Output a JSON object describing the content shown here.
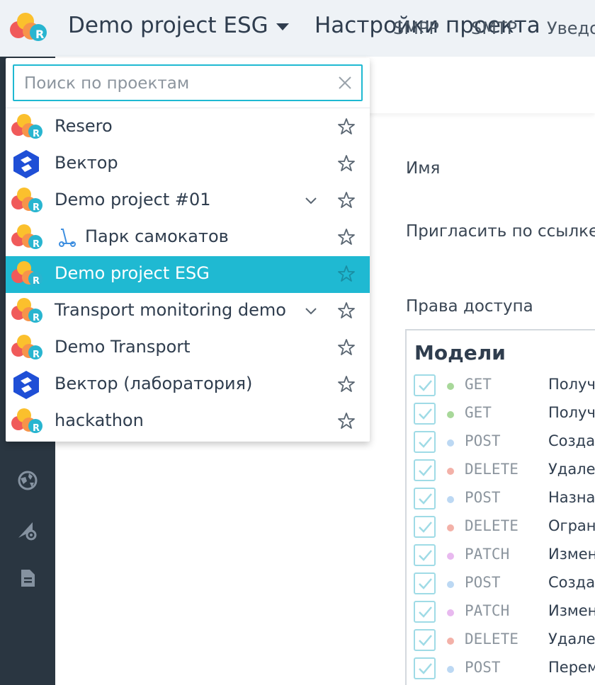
{
  "header": {
    "project_title": "Demo project ESG",
    "page_title": "Настройки проекта"
  },
  "tabs": [
    "SMPP",
    "SMTP",
    "Уведо"
  ],
  "form": {
    "name_label": "Имя",
    "invite_label": "Пригласить по ссылке",
    "access_label": "Права доступа"
  },
  "permissions": {
    "title": "Модели",
    "rows": [
      {
        "method": "GET",
        "desc": "Получ",
        "color": "#a8d89a"
      },
      {
        "method": "GET",
        "desc": "Получ",
        "color": "#a8d89a"
      },
      {
        "method": "POST",
        "desc": "Созда",
        "color": "#bcd8f3"
      },
      {
        "method": "DELETE",
        "desc": "Удале",
        "color": "#f3b1a8"
      },
      {
        "method": "POST",
        "desc": "Назна",
        "color": "#bcd8f3"
      },
      {
        "method": "DELETE",
        "desc": "Огран",
        "color": "#f3b1a8"
      },
      {
        "method": "PATCH",
        "desc": "Измен",
        "color": "#e8b9ef"
      },
      {
        "method": "POST",
        "desc": "Созда",
        "color": "#bcd8f3"
      },
      {
        "method": "PATCH",
        "desc": "Измен",
        "color": "#e8b9ef"
      },
      {
        "method": "DELETE",
        "desc": "Удале",
        "color": "#f3b1a8"
      },
      {
        "method": "POST",
        "desc": "Перем",
        "color": "#bcd8f3"
      }
    ]
  },
  "dropdown": {
    "search_placeholder": "Поиск по проектам",
    "projects": [
      {
        "name": "Resero",
        "icon": "resero-logo-icon",
        "chevron": false,
        "active": false,
        "scooter": false
      },
      {
        "name": "Вектор",
        "icon": "vector-logo-icon",
        "chevron": false,
        "active": false,
        "scooter": false
      },
      {
        "name": "Demo project #01",
        "icon": "resero-logo-icon",
        "chevron": true,
        "active": false,
        "scooter": false
      },
      {
        "name": "Парк самокатов",
        "icon": "resero-logo-icon",
        "chevron": false,
        "active": false,
        "scooter": true
      },
      {
        "name": "Demo project ESG",
        "icon": "resero-logo-icon",
        "chevron": false,
        "active": true,
        "scooter": false
      },
      {
        "name": "Transport monitoring demo",
        "icon": "resero-logo-icon",
        "chevron": true,
        "active": false,
        "scooter": false
      },
      {
        "name": "Demo Transport",
        "icon": "resero-logo-icon",
        "chevron": false,
        "active": false,
        "scooter": false
      },
      {
        "name": "Вектор (лаборатория)",
        "icon": "vector-logo-icon",
        "chevron": false,
        "active": false,
        "scooter": false
      },
      {
        "name": "hackathon",
        "icon": "resero-logo-icon",
        "chevron": false,
        "active": false,
        "scooter": false
      }
    ]
  },
  "colors": {
    "accent": "#1fb9d2",
    "sidebar": "#2a3641",
    "header_bg": "#eef2f6"
  },
  "sidebar_icons": [
    "globe-icon",
    "settings-triangle-icon",
    "document-icon"
  ]
}
